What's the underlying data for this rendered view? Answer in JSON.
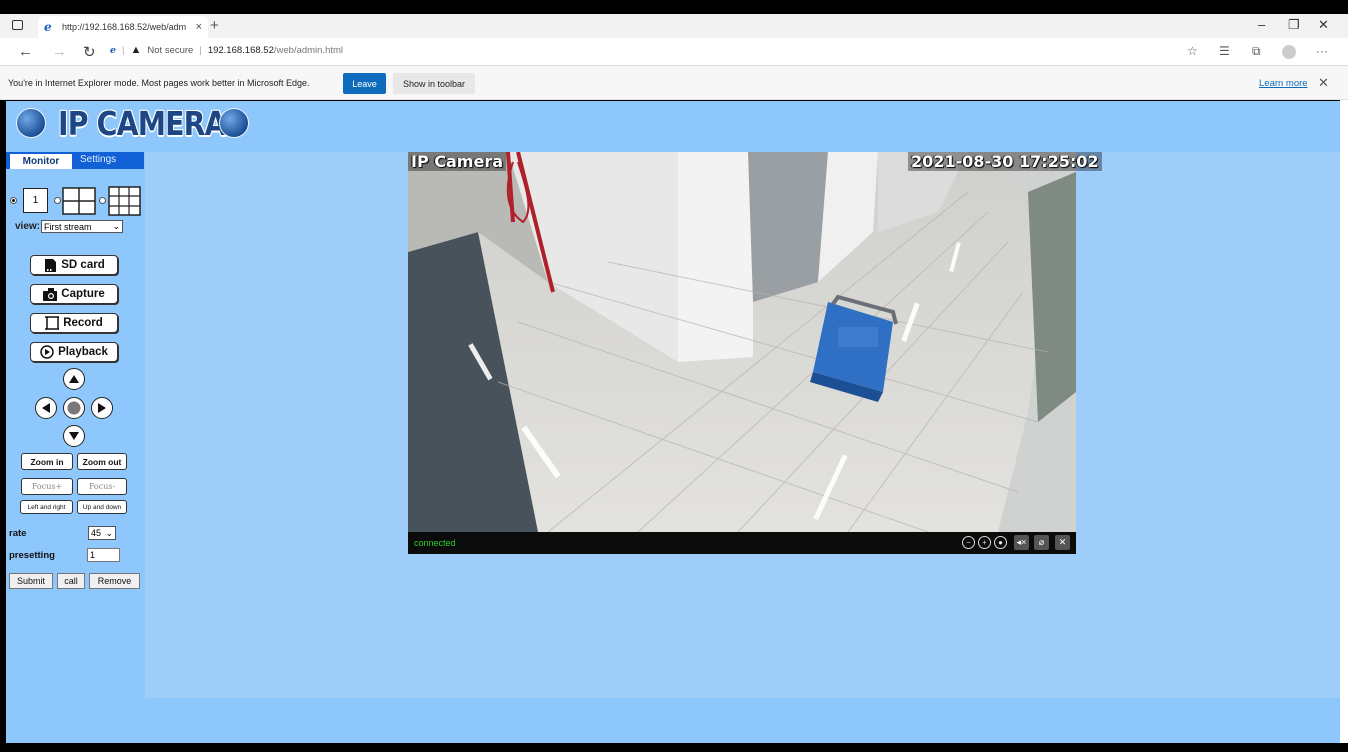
{
  "browser": {
    "tab_title": "http://192.168.168.52/web/adm",
    "tab_close": "×",
    "new_tab": "+",
    "window_controls": [
      "–",
      "❐",
      "✕"
    ],
    "address": {
      "not_secure": "Not secure",
      "host": "192.168.168.52",
      "path": "/web/admin.html"
    },
    "ie_banner": {
      "message": "You're in Internet Explorer mode. Most pages work better in Microsoft Edge.",
      "leave": "Leave",
      "show_in_toolbar": "Show in toolbar",
      "learn_more": "Learn more"
    }
  },
  "logo": {
    "text": "IP CAMERA"
  },
  "tabs": {
    "monitor": "Monitor",
    "settings": "Settings"
  },
  "layout": {
    "single_label": "1",
    "selected": "1"
  },
  "view": {
    "label": "view:",
    "selected": "First stream"
  },
  "buttons": {
    "sd_card": "SD card",
    "capture": "Capture",
    "record": "Record",
    "playback": "Playback",
    "zoom_in": "Zoom in",
    "zoom_out": "Zoom out",
    "focus_plus": "Focus+",
    "focus_minus": "Focus-",
    "left_right": "Left and right",
    "up_down": "Up and down",
    "submit": "Submit",
    "call": "call",
    "remove": "Remove"
  },
  "rate": {
    "label": "rate",
    "value": "45"
  },
  "presetting": {
    "label": "presetting",
    "value": "1"
  },
  "video": {
    "osd_name": "IP Camera",
    "osd_time": "2021-08-30 17:25:02",
    "status": "connected"
  },
  "icons": [
    "ie-icon",
    "tab-actions-icon",
    "back-icon",
    "forward-icon",
    "refresh-icon",
    "warning-icon",
    "favorites-icon",
    "collections-icon",
    "profile-icon",
    "more-icon",
    "globe-icon",
    "sd-card-icon",
    "camera-icon",
    "film-icon",
    "play-icon",
    "arrow-up-icon",
    "arrow-down-icon",
    "arrow-left-icon",
    "arrow-right-icon",
    "stop-icon",
    "zoom-out-icon",
    "zoom-in-icon",
    "mute-icon",
    "mic-off-icon",
    "tools-icon"
  ]
}
